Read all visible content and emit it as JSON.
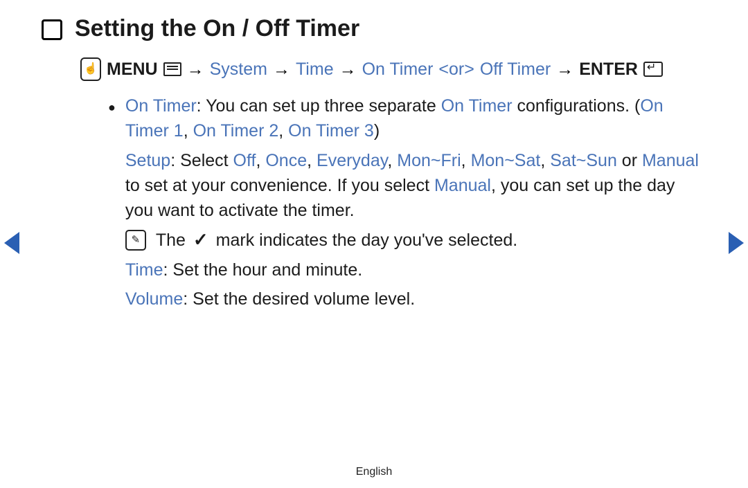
{
  "title": "Setting the On / Off Timer",
  "breadcrumb": {
    "menu": "MENU",
    "arrow": "→",
    "system": "System",
    "time": "Time",
    "ontimer": "On Timer",
    "or": "<or>",
    "offtimer": "Off Timer",
    "enter": "ENTER"
  },
  "content": {
    "ontimer_label": "On Timer",
    "ontimer_desc": ": You can set up three separate ",
    "ontimer_ref": "On Timer",
    "ontimer_desc2": " configurations. (",
    "ontimer_list": "On Timer 1",
    "comma1": ", ",
    "ontimer_list2": "On Timer 2",
    "comma2": ", ",
    "ontimer_list3": "On Timer 3",
    "close_paren": ")",
    "setup_label": "Setup",
    "setup_colon": ": Select ",
    "opt_off": "Off",
    "c1": ", ",
    "opt_once": "Once",
    "c2": ", ",
    "opt_every": "Everyday",
    "c3": ", ",
    "opt_mf": "Mon~Fri",
    "c4": ", ",
    "opt_ms": "Mon~Sat",
    "c5": ", ",
    "opt_ss": "Sat~Sun",
    "or_text": " or ",
    "opt_manual": "Manual",
    "setup_rest": " to set at your convenience. If you select ",
    "opt_manual2": "Manual",
    "setup_rest2": ", you can set up the day you want to activate the timer.",
    "note_pre": "The ",
    "note_post": " mark indicates the day you've selected.",
    "time_label": "Time",
    "time_text": ": Set the hour and minute.",
    "volume_label": "Volume",
    "volume_text": ": Set the desired volume level."
  },
  "footer": "English"
}
